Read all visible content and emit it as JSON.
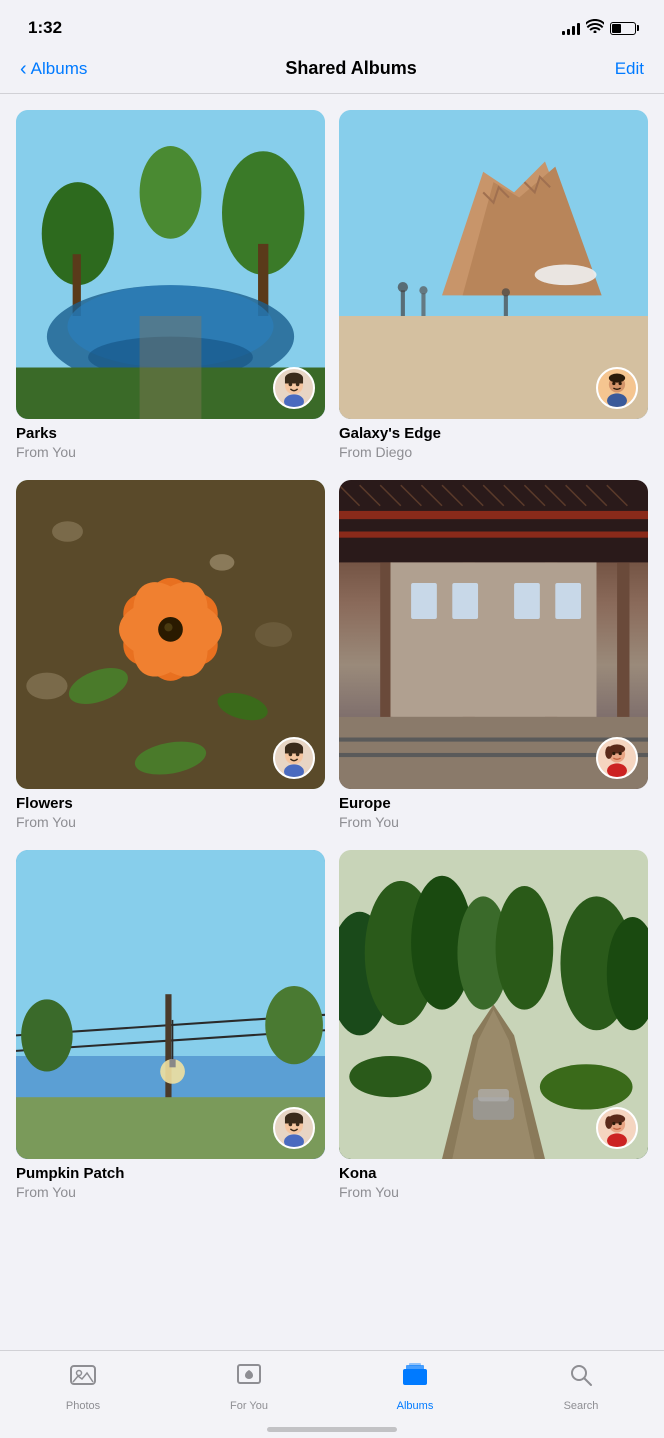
{
  "statusBar": {
    "time": "1:32",
    "signalBars": [
      4,
      6,
      8,
      11,
      14
    ],
    "batteryLevel": 40
  },
  "header": {
    "backLabel": "Albums",
    "title": "Shared Albums",
    "editLabel": "Edit"
  },
  "albums": [
    {
      "id": "parks",
      "name": "Parks",
      "from": "From You",
      "photoType": "park",
      "avatarType": "memoji-boy"
    },
    {
      "id": "galaxys-edge",
      "name": "Galaxy's Edge",
      "from": "From Diego",
      "photoType": "galaxy",
      "avatarType": "photo-man"
    },
    {
      "id": "flowers",
      "name": "Flowers",
      "from": "From You",
      "photoType": "flower",
      "avatarType": "memoji-boy"
    },
    {
      "id": "europe",
      "name": "Europe",
      "from": "From You",
      "photoType": "europe",
      "avatarType": "photo-woman-red"
    },
    {
      "id": "pumpkin-patch",
      "name": "Pumpkin Patch",
      "from": "From You",
      "photoType": "pumpkin",
      "avatarType": "memoji-boy"
    },
    {
      "id": "kona",
      "name": "Kona",
      "from": "From You",
      "photoType": "kona",
      "avatarType": "photo-woman-red"
    }
  ],
  "tabBar": {
    "items": [
      {
        "id": "photos",
        "label": "Photos",
        "icon": "photos",
        "active": false
      },
      {
        "id": "for-you",
        "label": "For You",
        "icon": "foryou",
        "active": false
      },
      {
        "id": "albums",
        "label": "Albums",
        "icon": "albums",
        "active": true
      },
      {
        "id": "search",
        "label": "Search",
        "icon": "search",
        "active": false
      }
    ]
  }
}
